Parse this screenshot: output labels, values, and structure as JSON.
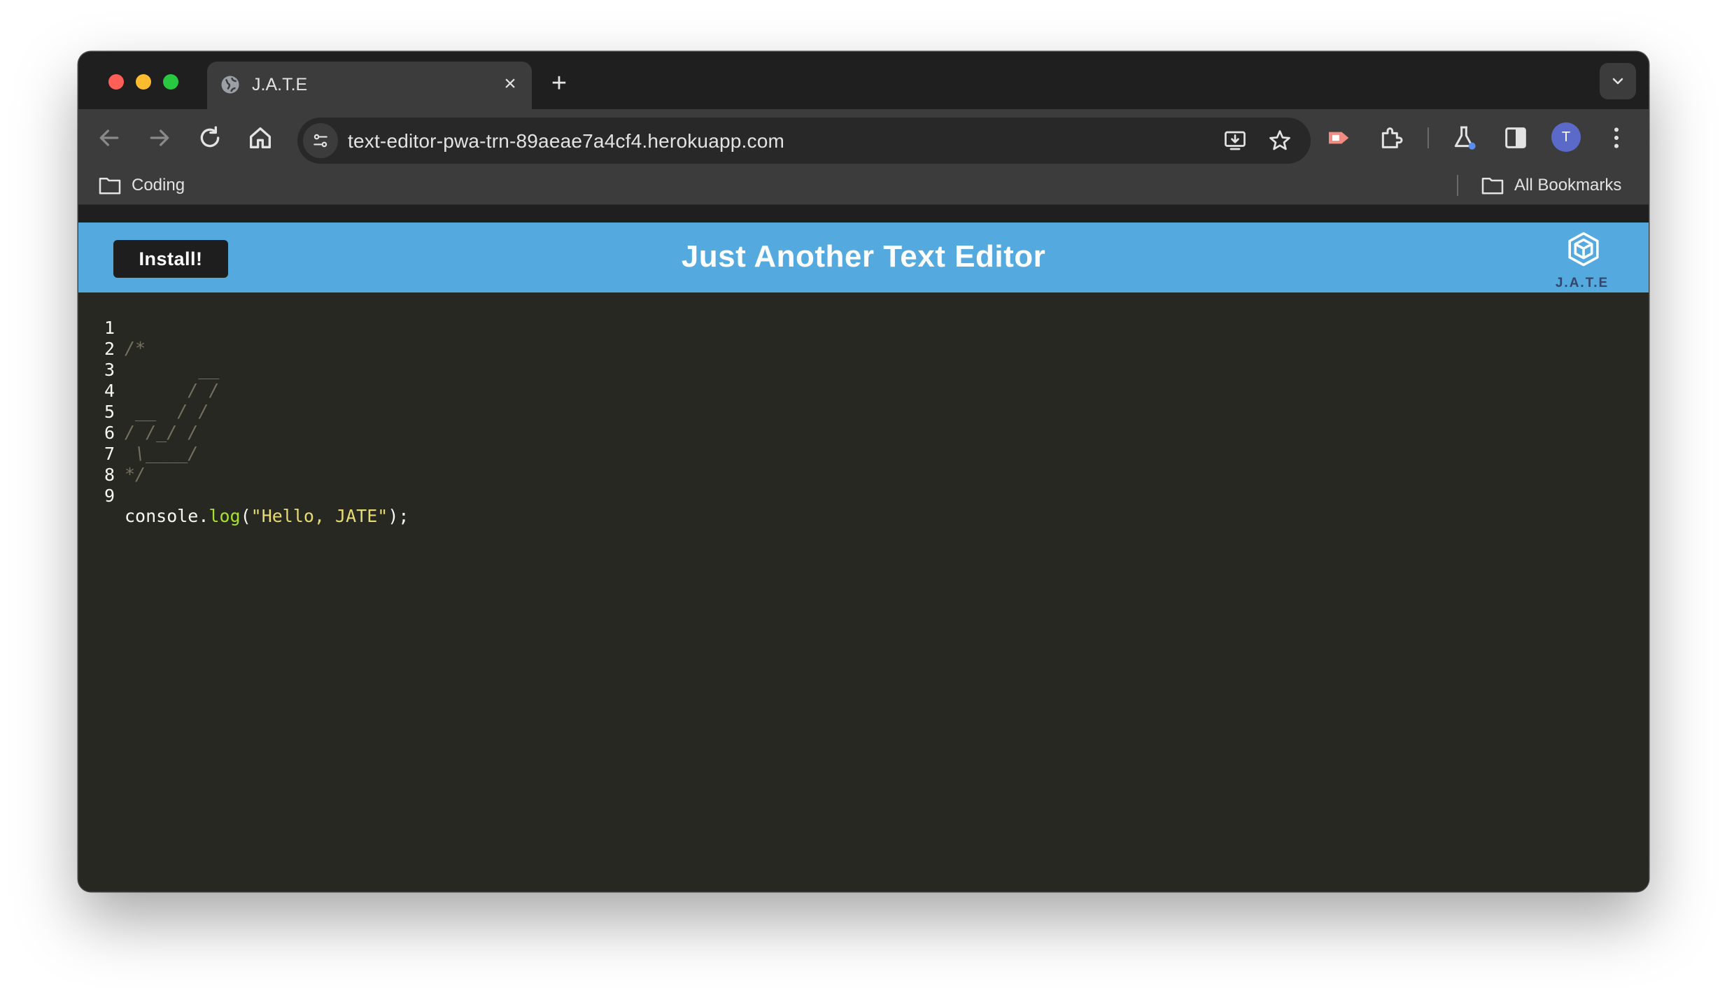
{
  "browser": {
    "tab_title": "J.A.T.E",
    "url": "text-editor-pwa-trn-89aeae7a4cf4.herokuapp.com",
    "bookmarks": [
      "Coding"
    ],
    "all_bookmarks_label": "All Bookmarks",
    "profile_initial": "T"
  },
  "app": {
    "install_label": "Install!",
    "title": "Just Another Text Editor",
    "logo_text": "J.A.T.E",
    "colors": {
      "navbar": "#54a9df",
      "editor_bg": "#272822",
      "comment": "#75715e",
      "function": "#a6e22e",
      "string": "#e6db74"
    }
  },
  "editor": {
    "line_numbers": [
      "1",
      "2",
      "3",
      "4",
      "5",
      "6",
      "7",
      "8",
      "9"
    ],
    "lines": [
      "/*",
      "       __",
      "      / /",
      " __  / /",
      "/ /_/ /",
      " \\____/",
      "*/",
      "",
      "console.log(\"Hello, JATE\");"
    ],
    "code_parts": {
      "object": "console.",
      "method": "log",
      "open": "(",
      "string": "\"Hello, JATE\"",
      "close": ");"
    }
  }
}
